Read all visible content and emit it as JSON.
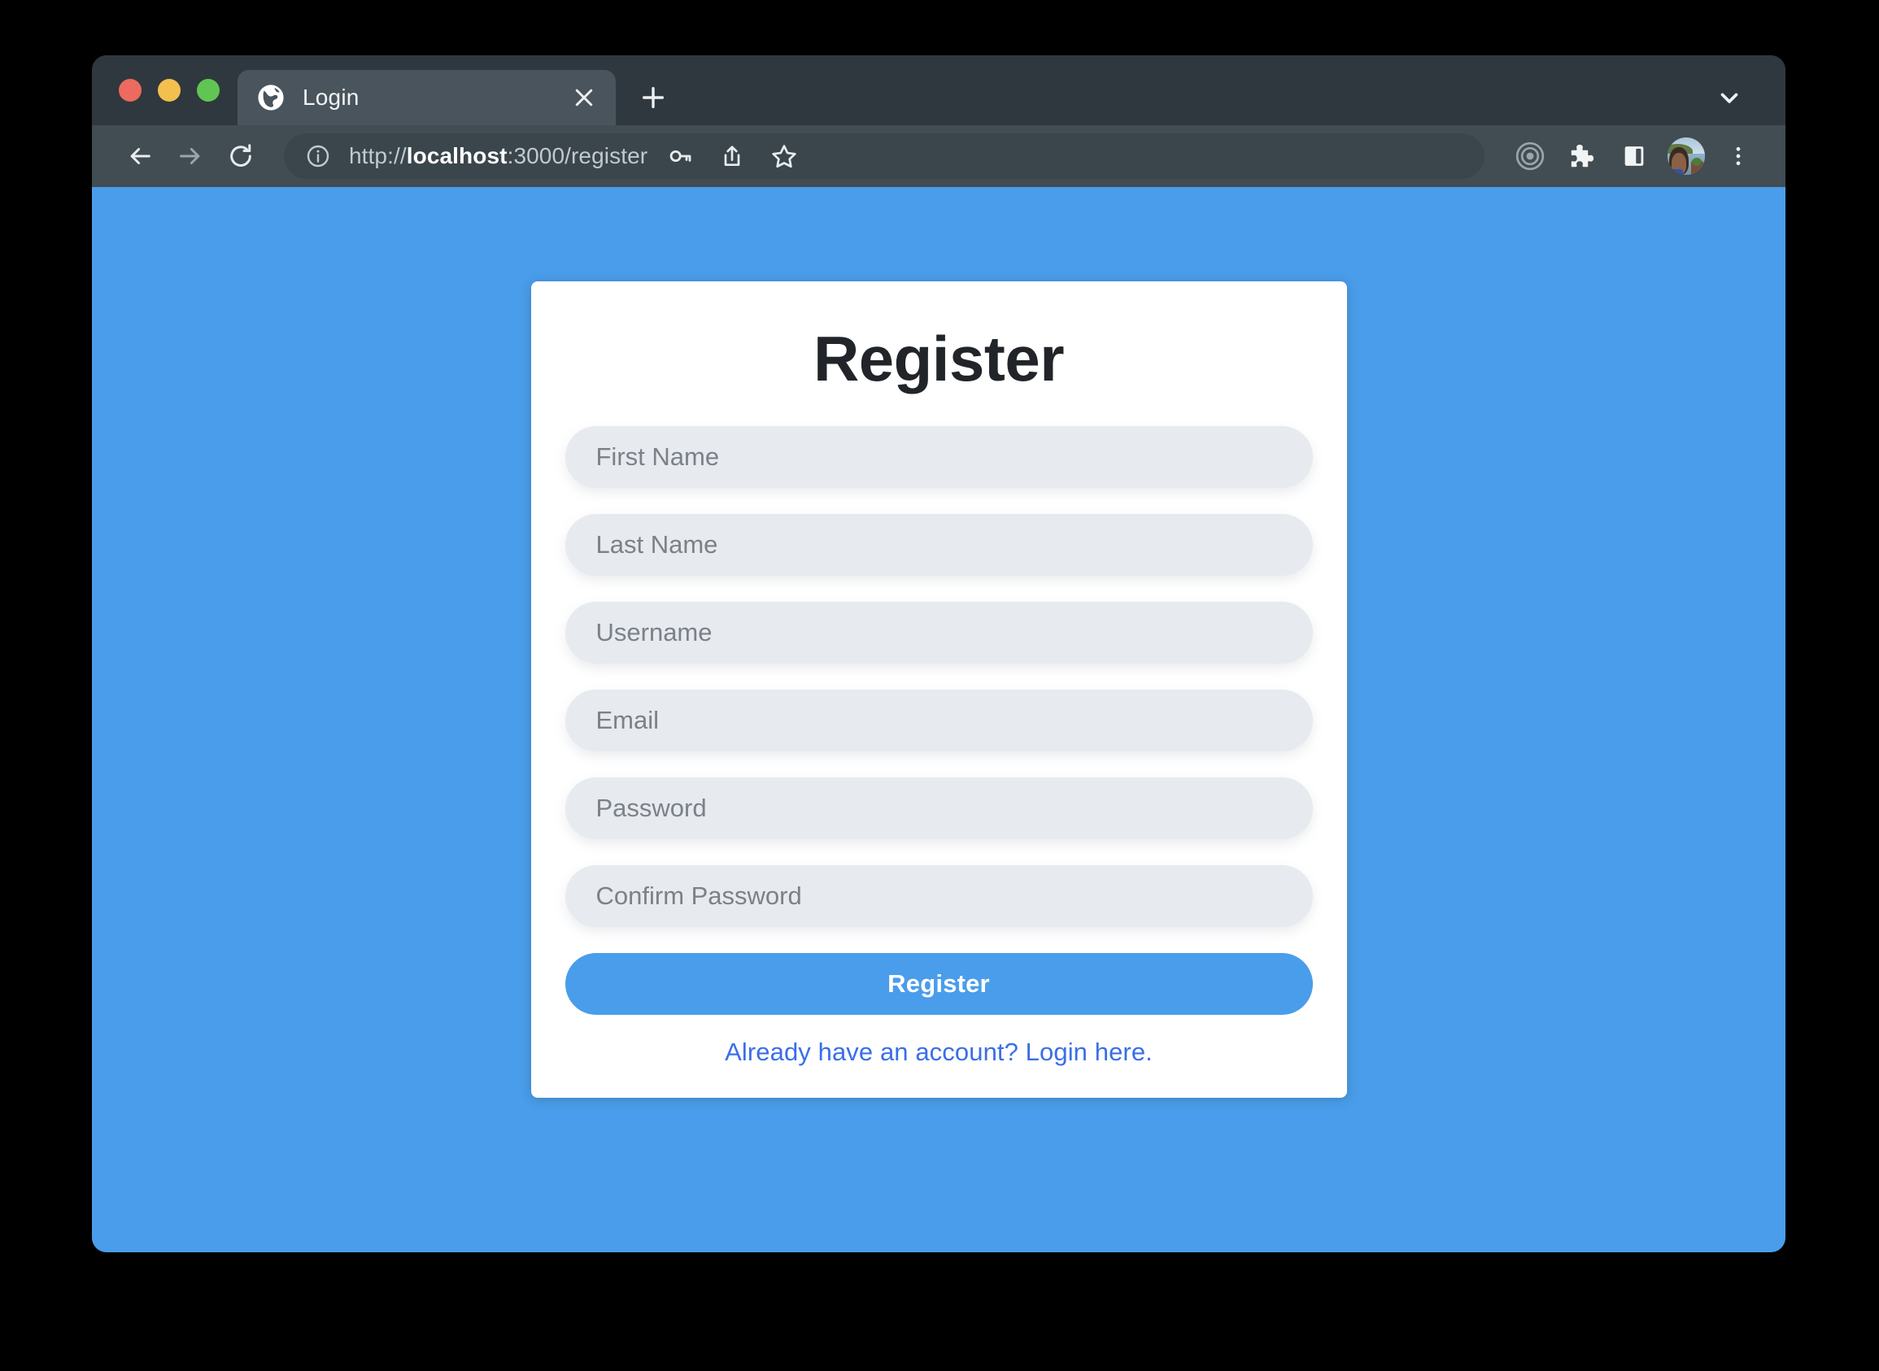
{
  "browser": {
    "window_controls": [
      "close",
      "minimize",
      "maximize"
    ],
    "tab": {
      "title": "Login",
      "favicon": "globe-icon",
      "close_label": "×"
    },
    "new_tab_label": "+",
    "tab_search_icon": "chevron-down-icon",
    "nav": {
      "back_icon": "back-arrow-icon",
      "forward_icon": "forward-arrow-icon",
      "reload_icon": "reload-icon"
    },
    "omnibox": {
      "security_icon": "info-circle-icon",
      "url_scheme": "http://",
      "url_host": "localhost",
      "url_rest": ":3000/register",
      "url_full": "http://localhost:3000/register",
      "actions": [
        "password-key-icon",
        "share-icon",
        "bookmark-star-icon"
      ]
    },
    "toolbar_icons": [
      "target-circle-icon",
      "extensions-puzzle-icon",
      "side-panel-icon",
      "profile-avatar",
      "overflow-menu-icon"
    ],
    "colors": {
      "tab_strip": "#2f383e",
      "toolbar": "#414c53",
      "active_tab": "#49545c",
      "omnibox": "#3a454c",
      "traffic_red": "#ec6a5e",
      "traffic_yellow": "#f3bf4f",
      "traffic_green": "#61c554"
    }
  },
  "page": {
    "background_color": "#4a9dea",
    "card": {
      "title": "Register",
      "fields": [
        {
          "name": "first-name",
          "placeholder": "First Name",
          "type": "text",
          "value": ""
        },
        {
          "name": "last-name",
          "placeholder": "Last Name",
          "type": "text",
          "value": ""
        },
        {
          "name": "username",
          "placeholder": "Username",
          "type": "text",
          "value": ""
        },
        {
          "name": "email",
          "placeholder": "Email",
          "type": "text",
          "value": ""
        },
        {
          "name": "password",
          "placeholder": "Password",
          "type": "password",
          "value": ""
        },
        {
          "name": "confirm-password",
          "placeholder": "Confirm Password",
          "type": "password",
          "value": ""
        }
      ],
      "submit_label": "Register",
      "login_link_text": "Already have an account? Login here.",
      "accent_color": "#4a9dea",
      "link_color": "#3a6ee8",
      "field_bg": "#e7eaee"
    }
  }
}
